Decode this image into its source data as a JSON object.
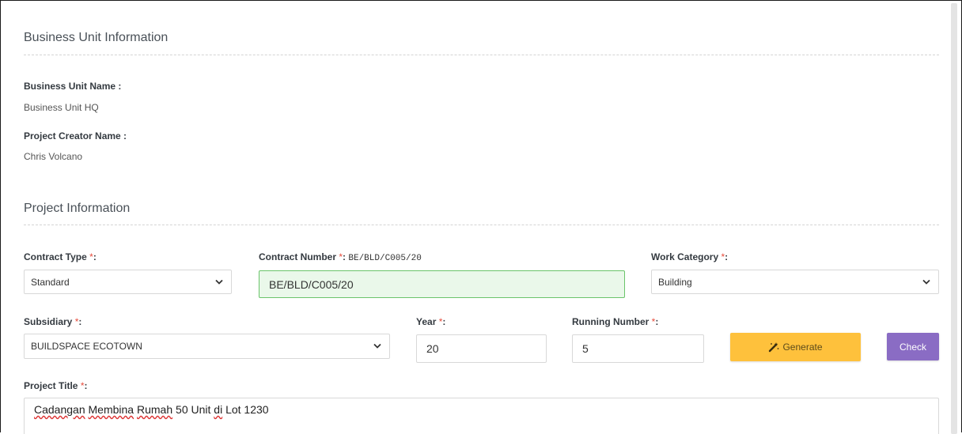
{
  "business_unit": {
    "section_title": "Business Unit Information",
    "name_label": "Business Unit Name :",
    "name_value": "Business Unit HQ",
    "creator_label": "Project Creator Name :",
    "creator_value": "Chris Volcano"
  },
  "project": {
    "section_title": "Project Information",
    "required_mark": "*",
    "contract_type": {
      "label": "Contract Type",
      "suffix": ":",
      "value": "Standard"
    },
    "contract_number": {
      "label": "Contract Number",
      "suffix": ":",
      "preview": "BE/BLD/C005/20",
      "value": "BE/BLD/C005/20"
    },
    "work_category": {
      "label": "Work Category",
      "suffix": ":",
      "value": "Building"
    },
    "subsidiary": {
      "label": "Subsidiary",
      "suffix": ":",
      "value": "BUILDSPACE ECOTOWN"
    },
    "year": {
      "label": "Year",
      "suffix": ":",
      "value": "20"
    },
    "running_number": {
      "label": "Running Number",
      "suffix": ":",
      "value": "5"
    },
    "generate_label": "Generate",
    "check_label": "Check",
    "project_title": {
      "label": "Project Title",
      "suffix": ":",
      "words": [
        "Cadangan",
        "Membina",
        "Rumah",
        "50 Unit",
        "di",
        "Lot 1230"
      ]
    }
  },
  "colors": {
    "required": "#e74c3c",
    "generate_button": "#fec13c",
    "check_button": "#8a6cc4",
    "valid_input_bg": "#eaf8ea",
    "valid_input_border": "#6ac46a"
  },
  "icons": {
    "generate": "magic-wand-icon",
    "dropdown": "chevron-down-icon"
  }
}
